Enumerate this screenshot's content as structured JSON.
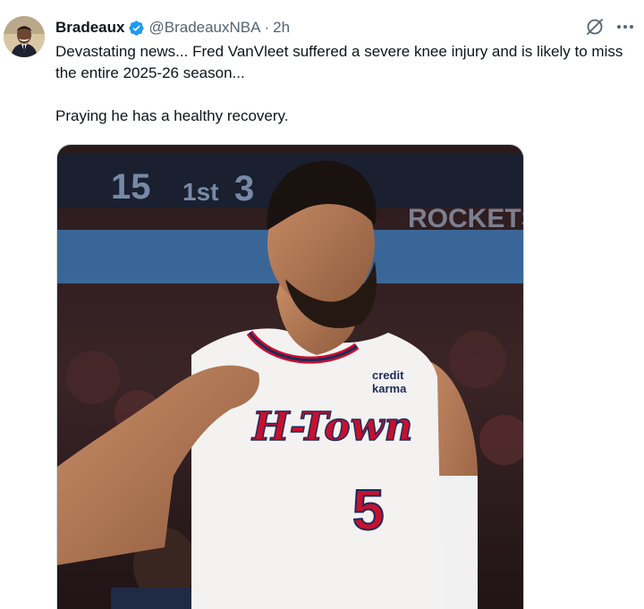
{
  "tweet": {
    "author": {
      "display_name": "Bradeaux",
      "handle": "@BradeauxNBA",
      "separator": "·",
      "time": "2h",
      "verified": true
    },
    "text_lines": [
      "Devastating news... Fred VanVleet suffered a severe knee injury and is likely to miss the entire 2025-26 season...",
      "Praying he has a healthy recovery."
    ],
    "media": {
      "jersey_text": "H-Town",
      "jersey_number": "5",
      "sponsor_line1": "credit",
      "sponsor_line2": "karma",
      "scoreboard": [
        "15",
        "1st",
        "3"
      ],
      "banner_text": "ROCKETS"
    },
    "icons": {
      "verified": "verified-badge-icon",
      "grok": "grok-icon",
      "more": "more-options-icon"
    },
    "colors": {
      "verified_blue": "#1d9bf0",
      "text_primary": "#0f1419",
      "text_secondary": "#536471",
      "jersey_red": "#c8102e"
    }
  }
}
